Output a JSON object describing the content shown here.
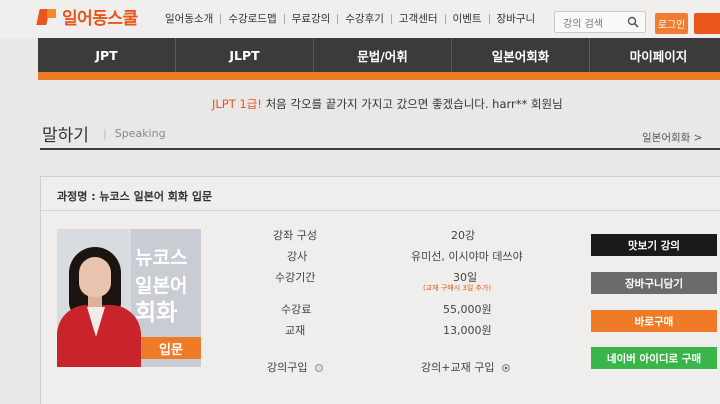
{
  "header": {
    "logo_text": "일어동스쿨",
    "nav": [
      "일어동소개",
      "수강로드맵",
      "무료강의",
      "수강후기",
      "고객센터",
      "이벤트",
      "장바구니"
    ],
    "search_placeholder": "강의 검색",
    "login_label": "로그인"
  },
  "main_nav": {
    "tabs": [
      "JPT",
      "JLPT",
      "문법/어휘",
      "일본어회화",
      "마이페이지"
    ]
  },
  "banner": {
    "highlight": "JLPT 1급!",
    "text": " 처음 각오를 끝가지 가지고 갔으면 좋겠습니다. harr** 회원님"
  },
  "section": {
    "title": "말하기",
    "subtitle": "Speaking",
    "breadcrumb": "일본어회화 >"
  },
  "course": {
    "name": "과정명 : 뉴코스 일본어 회화 입문",
    "thumbnail": {
      "line1": "뉴코스",
      "line2": "일본어",
      "line3": "회화",
      "level": "입문"
    },
    "details": {
      "composition_label": "강좌 구성",
      "composition_value": "20강",
      "instructor_label": "강사",
      "instructor_value": "유미선, 이시야마 데쓰야",
      "period_label": "수강기간",
      "period_value": "30일",
      "period_note": "(교재 구매시 3일 추가)",
      "fee_label": "수강료",
      "fee_value": "55,000원",
      "textbook_label": "교재",
      "textbook_value": "13,000원"
    },
    "options": {
      "lecture_only": "강의구입",
      "lecture_plus_book": "강의+교재 구입",
      "selected": "lecture_plus_book"
    },
    "buttons": {
      "preview": "맛보기 강의",
      "cart": "장바구니담기",
      "buy": "바로구매",
      "naver": "네이버 아이디로 구매"
    }
  },
  "colors": {
    "accent_orange": "#ef7a28",
    "brand_red": "#e8561c",
    "nav_dark": "#3b3b3c",
    "naver_green": "#3ab54a"
  }
}
